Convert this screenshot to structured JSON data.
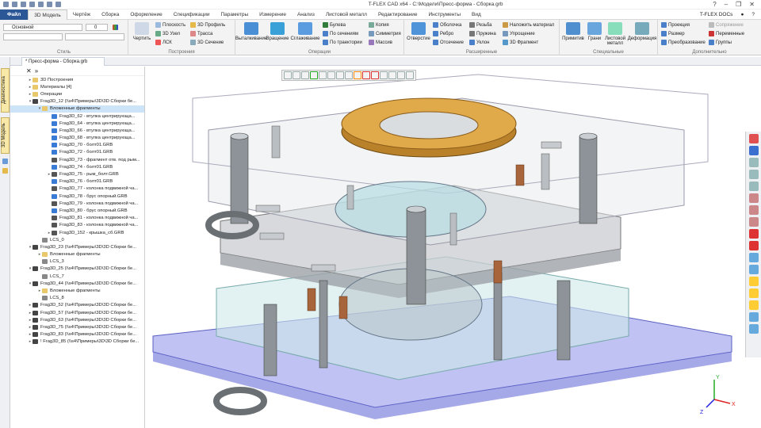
{
  "title": "T-FLEX CAD x64 - C:\\Модели\\Пресс-форма - Сборка.grb",
  "window_controls": [
    "?",
    "–",
    "❐",
    "✕"
  ],
  "menu": {
    "file": "Файл",
    "tabs": [
      "3D Модель",
      "Чертёж",
      "Сборка",
      "Оформление",
      "Спецификации",
      "Параметры",
      "Измерение",
      "Анализ",
      "Листовой металл",
      "Редактирование",
      "Инструменты",
      "Вид"
    ],
    "docs": "T-FLEX DOCs"
  },
  "ribbon": {
    "style": {
      "layer": "Основной",
      "value": "0",
      "label": "Стиль"
    },
    "build": {
      "draw": "Чертить",
      "plane": "Плоскость",
      "node3d": "3D Узел",
      "lsk": "ЛСК",
      "profile3d": "3D Профиль",
      "path": "Трасса",
      "section3d": "3D Сечение",
      "label": "Построения"
    },
    "ops": {
      "extrude": "Выталкивание",
      "rotate": "Вращение",
      "smooth": "Сглаживание",
      "bool": "Булева",
      "by_sections": "По сечениям",
      "by_path": "По траектории",
      "copy": "Копия",
      "symmetry": "Симметрия",
      "array": "Массив",
      "label": "Операции"
    },
    "ext": {
      "hole": "Отверстие",
      "shell": "Оболочка",
      "rib": "Ребро",
      "cutoff": "Отсечение",
      "thread": "Резьба",
      "spring": "Пружина",
      "slope": "Уклон",
      "material": "Наложить материал",
      "simplify": "Упрощение",
      "fragment": "3D Фрагмент",
      "label": "Расширенные"
    },
    "special": {
      "primitive": "Примитив",
      "faces": "Грани",
      "sheet": "Листовой металл",
      "deform": "Деформация",
      "label": "Специальные"
    },
    "extra": {
      "projection": "Проекция",
      "size": "Размер",
      "transform": "Преобразование",
      "mate": "Сопряжение",
      "vars": "Переменные",
      "groups": "Группы",
      "label": "Дополнительно"
    }
  },
  "doc_tab": "* Пресс-форма - Сборка.grb",
  "side_tabs": [
    "Диагностика",
    "3D Модель"
  ],
  "tree": [
    {
      "d": 0,
      "t": "3D Построения",
      "c": "#e8c86a",
      "e": "▸"
    },
    {
      "d": 0,
      "t": "Материалы [4]",
      "c": "#e8c86a",
      "e": "▸"
    },
    {
      "d": 0,
      "t": "Операции",
      "c": "#e8c86a",
      "e": "▸"
    },
    {
      "d": 0,
      "t": "Frag3D_12 (\\\\s4\\Примеры\\3D\\3D Сборки бе...",
      "c": "#444",
      "e": "▾"
    },
    {
      "d": 1,
      "t": "Вложенные фрагменты",
      "c": "#e8c86a",
      "e": "▾"
    },
    {
      "d": 2,
      "t": "Frag3D_62 - втулка центрирующа...",
      "c": "#3a7bd5",
      "e": ""
    },
    {
      "d": 2,
      "t": "Frag3D_64 - втулка центрирующа...",
      "c": "#3a7bd5",
      "e": ""
    },
    {
      "d": 2,
      "t": "Frag3D_66 - втулка центрирующа...",
      "c": "#3a7bd5",
      "e": ""
    },
    {
      "d": 2,
      "t": "Frag3D_68 - втулка центрирующа...",
      "c": "#3a7bd5",
      "e": ""
    },
    {
      "d": 2,
      "t": "Frag3D_70 - болт01.GRB",
      "c": "#3a7bd5",
      "e": ""
    },
    {
      "d": 2,
      "t": "Frag3D_72 - болт01.GRB",
      "c": "#3a7bd5",
      "e": ""
    },
    {
      "d": 2,
      "t": "Frag3D_73 - фрагмент отв. под рым...",
      "c": "#555",
      "e": ""
    },
    {
      "d": 2,
      "t": "Frag3D_74 - болт01.GRB",
      "c": "#3a7bd5",
      "e": ""
    },
    {
      "d": 2,
      "t": "Frag3D_75 - рым_болт.GRB",
      "c": "#555",
      "e": "▸"
    },
    {
      "d": 2,
      "t": "Frag3D_76 - болт01.GRB",
      "c": "#3a7bd5",
      "e": ""
    },
    {
      "d": 2,
      "t": "Frag3D_77 - колонка подвижной ча...",
      "c": "#555",
      "e": ""
    },
    {
      "d": 2,
      "t": "Frag3D_78 - брус опорный.GRB",
      "c": "#3a7bd5",
      "e": ""
    },
    {
      "d": 2,
      "t": "Frag3D_79 - колонка подвижной ча...",
      "c": "#555",
      "e": ""
    },
    {
      "d": 2,
      "t": "Frag3D_80 - брус опорный.GRB",
      "c": "#3a7bd5",
      "e": ""
    },
    {
      "d": 2,
      "t": "Frag3D_81 - колонка подвижной ча...",
      "c": "#555",
      "e": ""
    },
    {
      "d": 2,
      "t": "Frag3D_83 - колонка подвижной ча...",
      "c": "#555",
      "e": ""
    },
    {
      "d": 2,
      "t": "Frag3D_152 - крышка_сб.GRB",
      "c": "#555",
      "e": "▸"
    },
    {
      "d": 1,
      "t": "LCS_0",
      "c": "#888",
      "e": ""
    },
    {
      "d": 0,
      "t": "Frag3D_23 (\\\\s4\\Примеры\\3D\\3D Сборки бе...",
      "c": "#444",
      "e": "▾"
    },
    {
      "d": 1,
      "t": "Вложенные фрагменты",
      "c": "#e8c86a",
      "e": "▸"
    },
    {
      "d": 1,
      "t": "LCS_3",
      "c": "#888",
      "e": ""
    },
    {
      "d": 0,
      "t": "Frag3D_25 (\\\\s4\\Примеры\\3D\\3D Сборки бе...",
      "c": "#444",
      "e": "▾"
    },
    {
      "d": 1,
      "t": "LCS_7",
      "c": "#888",
      "e": ""
    },
    {
      "d": 0,
      "t": "Frag3D_44 (\\\\s4\\Примеры\\3D\\3D Сборки бе...",
      "c": "#444",
      "e": "▾"
    },
    {
      "d": 1,
      "t": "Вложенные фрагменты",
      "c": "#e8c86a",
      "e": "▸"
    },
    {
      "d": 1,
      "t": "LCS_8",
      "c": "#888",
      "e": ""
    },
    {
      "d": 0,
      "t": "Frag3D_52 (\\\\s4\\Примеры\\3D\\3D Сборки бе...",
      "c": "#444",
      "e": "▸"
    },
    {
      "d": 0,
      "t": "Frag3D_57 (\\\\s4\\Примеры\\3D\\3D Сборки бе...",
      "c": "#444",
      "e": "▸"
    },
    {
      "d": 0,
      "t": "Frag3D_63 (\\\\s4\\Примеры\\3D\\3D Сборки бе...",
      "c": "#444",
      "e": "▸"
    },
    {
      "d": 0,
      "t": "Frag3D_75 (\\\\s4\\Примеры\\3D\\3D Сборки бе...",
      "c": "#444",
      "e": "▸"
    },
    {
      "d": 0,
      "t": "Frag3D_83 (\\\\s4\\Примеры\\3D\\3D Сборки бе...",
      "c": "#444",
      "e": "▸"
    },
    {
      "d": 0,
      "t": "! Frag3D_85 (\\\\s4\\Примеры\\3D\\3D Сборки бе...",
      "c": "#444",
      "e": "▸"
    }
  ],
  "axes": {
    "x": "X",
    "y": "Y",
    "z": "Z"
  }
}
